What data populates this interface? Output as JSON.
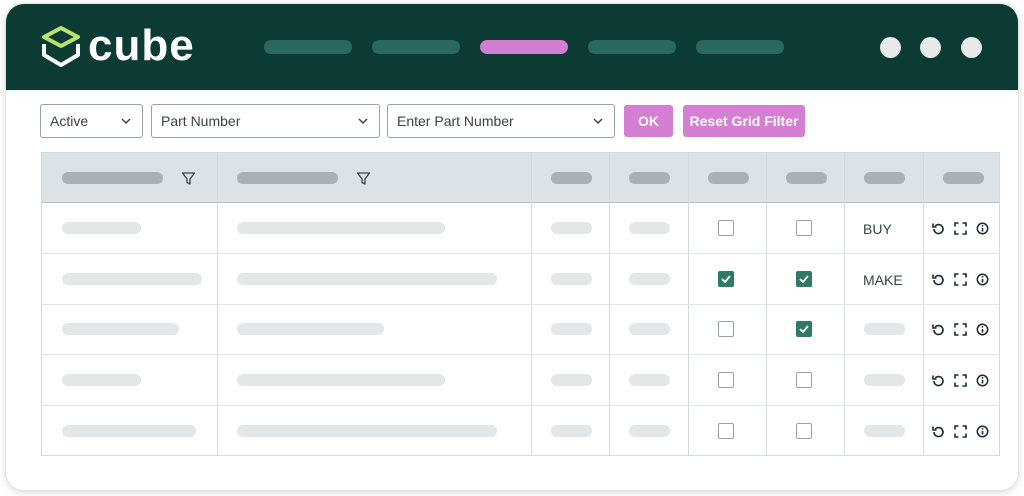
{
  "app": {
    "brand": "cube"
  },
  "colors": {
    "header_bg": "#0c3b33",
    "accent": "#d47fd3",
    "nav_inactive": "#2a6a5e",
    "check": "#2f7a64"
  },
  "nav": {
    "items": [
      {
        "state": "inactive"
      },
      {
        "state": "inactive"
      },
      {
        "state": "active"
      },
      {
        "state": "inactive"
      },
      {
        "state": "inactive"
      }
    ]
  },
  "window_controls": [
    "circle-button",
    "circle-button",
    "circle-button"
  ],
  "toolbar": {
    "status_select": "Active",
    "field_select": "Part Number",
    "value_select_placeholder": "Enter Part Number",
    "ok_label": "OK",
    "reset_label": "Reset Grid Filter"
  },
  "grid": {
    "rows": [
      {
        "col5_checked": false,
        "col6_checked": false,
        "type": "BUY"
      },
      {
        "col5_checked": true,
        "col6_checked": true,
        "type": "MAKE"
      },
      {
        "col5_checked": false,
        "col6_checked": true,
        "type": ""
      },
      {
        "col5_checked": false,
        "col6_checked": false,
        "type": ""
      },
      {
        "col5_checked": false,
        "col6_checked": false,
        "type": ""
      }
    ],
    "row_actions": [
      "refresh-icon",
      "expand-icon",
      "info-icon"
    ]
  }
}
